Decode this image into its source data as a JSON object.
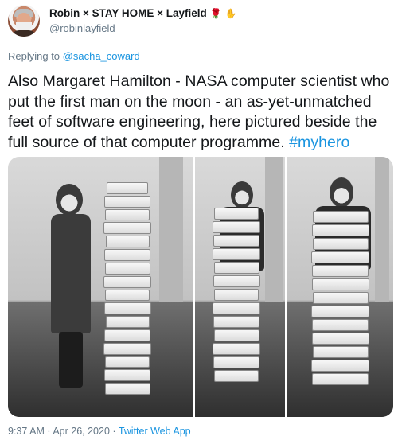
{
  "author": {
    "display_name": "Robin × STAY HOME × Layfield",
    "rose_icon": "rose-icon",
    "rose_glyph": "🌹",
    "hand_icon": "raised-hand-icon",
    "hand_glyph": "✋",
    "handle": "@robinlayfield"
  },
  "reply": {
    "prefix": "Replying to",
    "mention": "@sacha_coward"
  },
  "tweet": {
    "text": "Also Margaret Hamilton - NASA computer scientist who put the first man on the moon - an as-yet-unmatched feet of software engineering, here pictured beside the full source of that computer programme.",
    "hashtag": "#myhero"
  },
  "media": {
    "photo_count": 3
  },
  "footer": {
    "time": "9:37 AM",
    "separator": "·",
    "date": "Apr 26, 2020",
    "source": "Twitter Web App"
  },
  "colors": {
    "link": "#1b95e0",
    "secondary_text": "#657786",
    "primary_text": "#14171a"
  }
}
